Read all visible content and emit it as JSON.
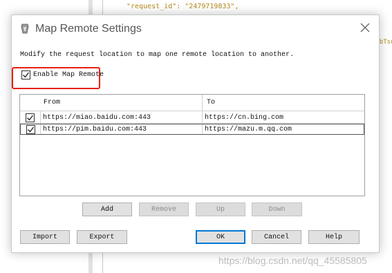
{
  "background": {
    "code_line": "\"request_id\": \"2479719833\",",
    "code_fragment": "ndbTsu"
  },
  "watermark": "https://blog.csdn.net/qq_45585805",
  "dialog": {
    "title": "Map Remote Settings",
    "description": "Modify the request location to map one remote location to another.",
    "enable_label": "Enable Map Remote",
    "enable_checked": true,
    "table": {
      "headers": [
        "From",
        "To"
      ],
      "rows": [
        {
          "checked": true,
          "from": "https://miao.baidu.com:443",
          "to": "https://cn.bing.com"
        },
        {
          "checked": true,
          "from": "https://pim.baidu.com:443",
          "to": "https://mazu.m.qq.com"
        }
      ]
    },
    "buttons": {
      "add": "Add",
      "remove": "Remove",
      "up": "Up",
      "down": "Down",
      "import": "Import",
      "export": "Export",
      "ok": "OK",
      "cancel": "Cancel",
      "help": "Help"
    },
    "colors": {
      "highlight_box": "#e8200f",
      "default_button_border": "#0078d7"
    }
  }
}
